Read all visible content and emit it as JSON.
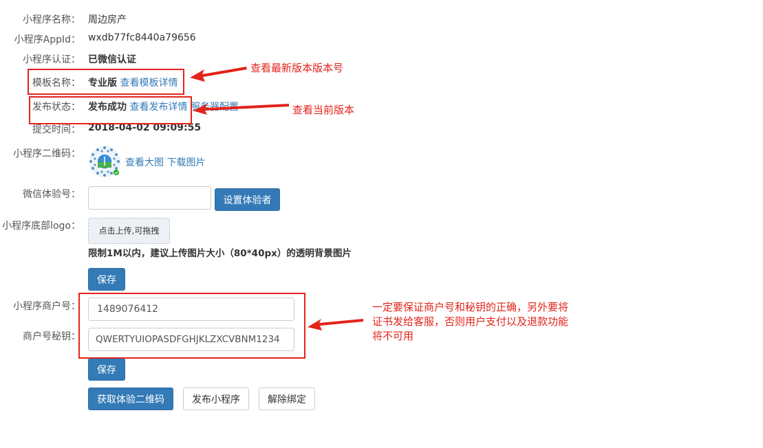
{
  "fields": {
    "name_label": "小程序名称：",
    "name_value": "周边房产",
    "appid_label": "小程序AppId：",
    "appid_value": "wxdb77fc8440a79656",
    "auth_label": "小程序认证：",
    "auth_value": "已微信认证",
    "template_label": "模板名称：",
    "template_value": "专业版",
    "template_link": "查看模板详情",
    "publish_label": "发布状态：",
    "publish_value": "发布成功",
    "publish_link": "查看发布详情",
    "server_link": "服务器配置",
    "submit_label": "提交时间：",
    "submit_value": "2018-04-02 09:09:55",
    "qr_label": "小程序二维码：",
    "qr_view_link": "查看大图",
    "qr_download_link": "下载图片",
    "tester_label": "微信体验号：",
    "tester_value": "",
    "tester_button": "设置体验者",
    "logo_label": "小程序底部logo：",
    "upload_text": "点击上传,可拖拽",
    "upload_hint": "限制1M以内，建议上传图片大小（80*40px）的透明背景图片",
    "save_button_1": "保存",
    "merchant_label": "小程序商户号：",
    "merchant_value": "1489076412",
    "secret_label": "商户号秘钥：",
    "secret_value": "QWERTYUIOPASDFGHJKLZXCVBNM1234",
    "save_button_2": "保存",
    "get_qr_button": "获取体验二维码",
    "publish_button": "发布小程序",
    "unbind_button": "解除绑定"
  },
  "annotations": {
    "template_note": "查看最新版本版本号",
    "publish_note": "查看当前版本",
    "merchant_note_line1": "一定要保证商户号和秘钥的正确，另外要将",
    "merchant_note_line2": "证书发给客服，否则用户支付以及退款功能",
    "merchant_note_line3": "将不可用"
  },
  "colors": {
    "primary": "#337ab7",
    "link": "#337ab7",
    "annotation_red": "#e2231a"
  }
}
